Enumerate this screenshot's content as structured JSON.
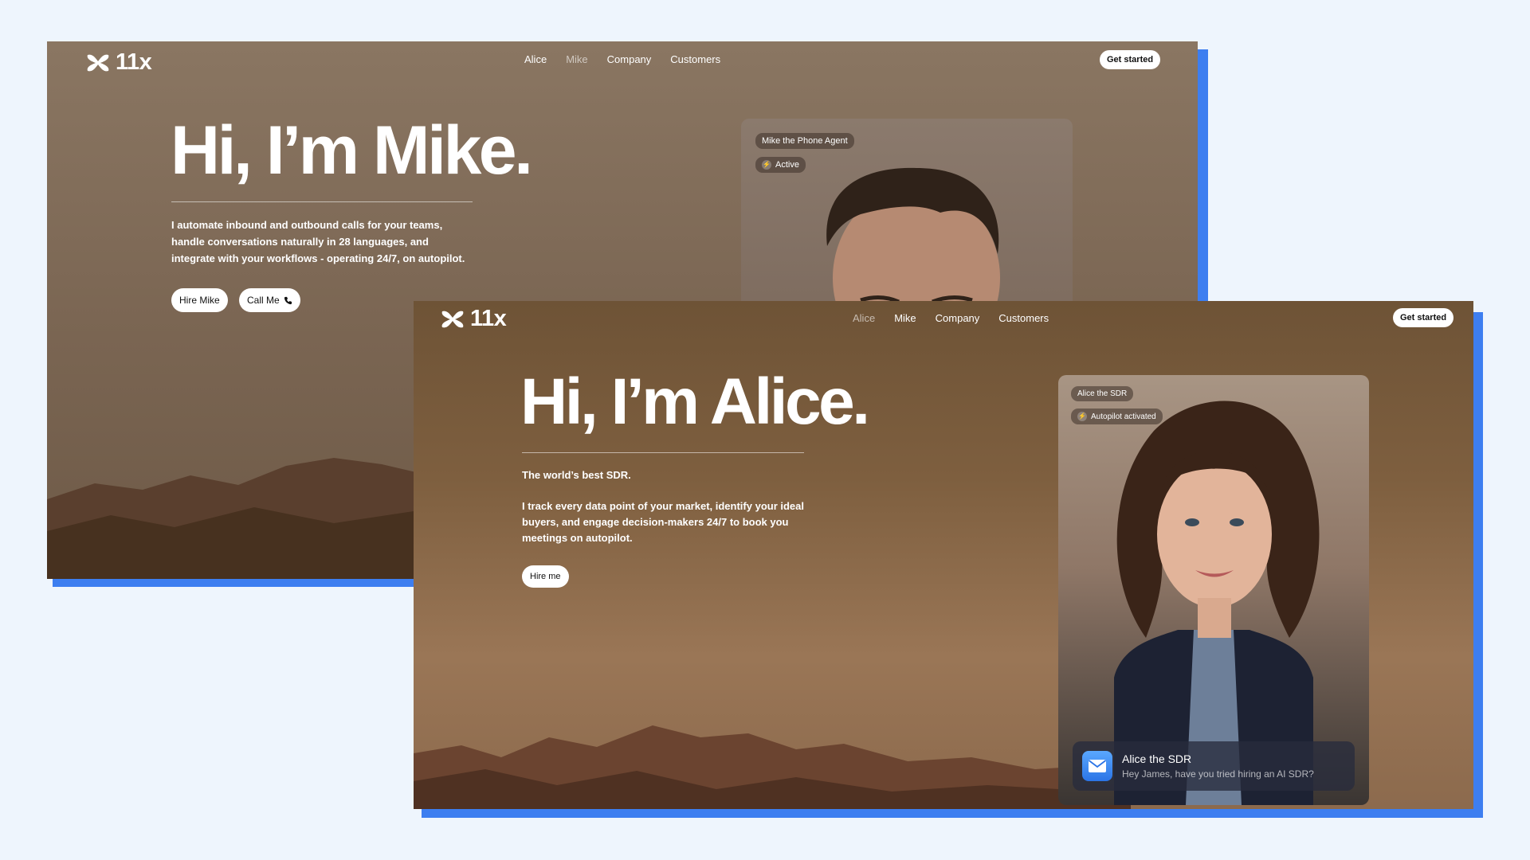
{
  "brand": {
    "name": "11x"
  },
  "mike_page": {
    "nav": {
      "links": [
        "Alice",
        "Mike",
        "Company",
        "Customers"
      ],
      "active": "Mike",
      "cta": "Get started"
    },
    "hero": {
      "title": "Hi, I’m Mike.",
      "description_lines": [
        "I automate inbound and outbound calls for your teams,",
        "handle conversations naturally in 28 languages, and",
        "integrate with your workflows - operating 24/7, on autopilot."
      ],
      "buttons": {
        "hire": "Hire Mike",
        "call": "Call Me"
      }
    },
    "agent_card": {
      "name": "Mike the Phone Agent",
      "status": "Active"
    }
  },
  "alice_page": {
    "nav": {
      "links": [
        "Alice",
        "Mike",
        "Company",
        "Customers"
      ],
      "active": "Alice",
      "cta": "Get started"
    },
    "hero": {
      "title": "Hi, I’m Alice.",
      "tagline": "The world’s best SDR.",
      "description_lines": [
        "I track every data point of your market, identify your ideal",
        "buyers, and engage decision-makers 24/7 to book you",
        "meetings on autopilot."
      ],
      "buttons": {
        "hire": "Hire me"
      }
    },
    "agent_card": {
      "name": "Alice the SDR",
      "status": "Autopilot activated",
      "message": {
        "title": "Alice the SDR",
        "text": "Hey James, have you tried hiring an AI SDR?"
      }
    }
  },
  "colors": {
    "accent_shadow": "#3d7ef0",
    "background": "#eef5fd"
  }
}
